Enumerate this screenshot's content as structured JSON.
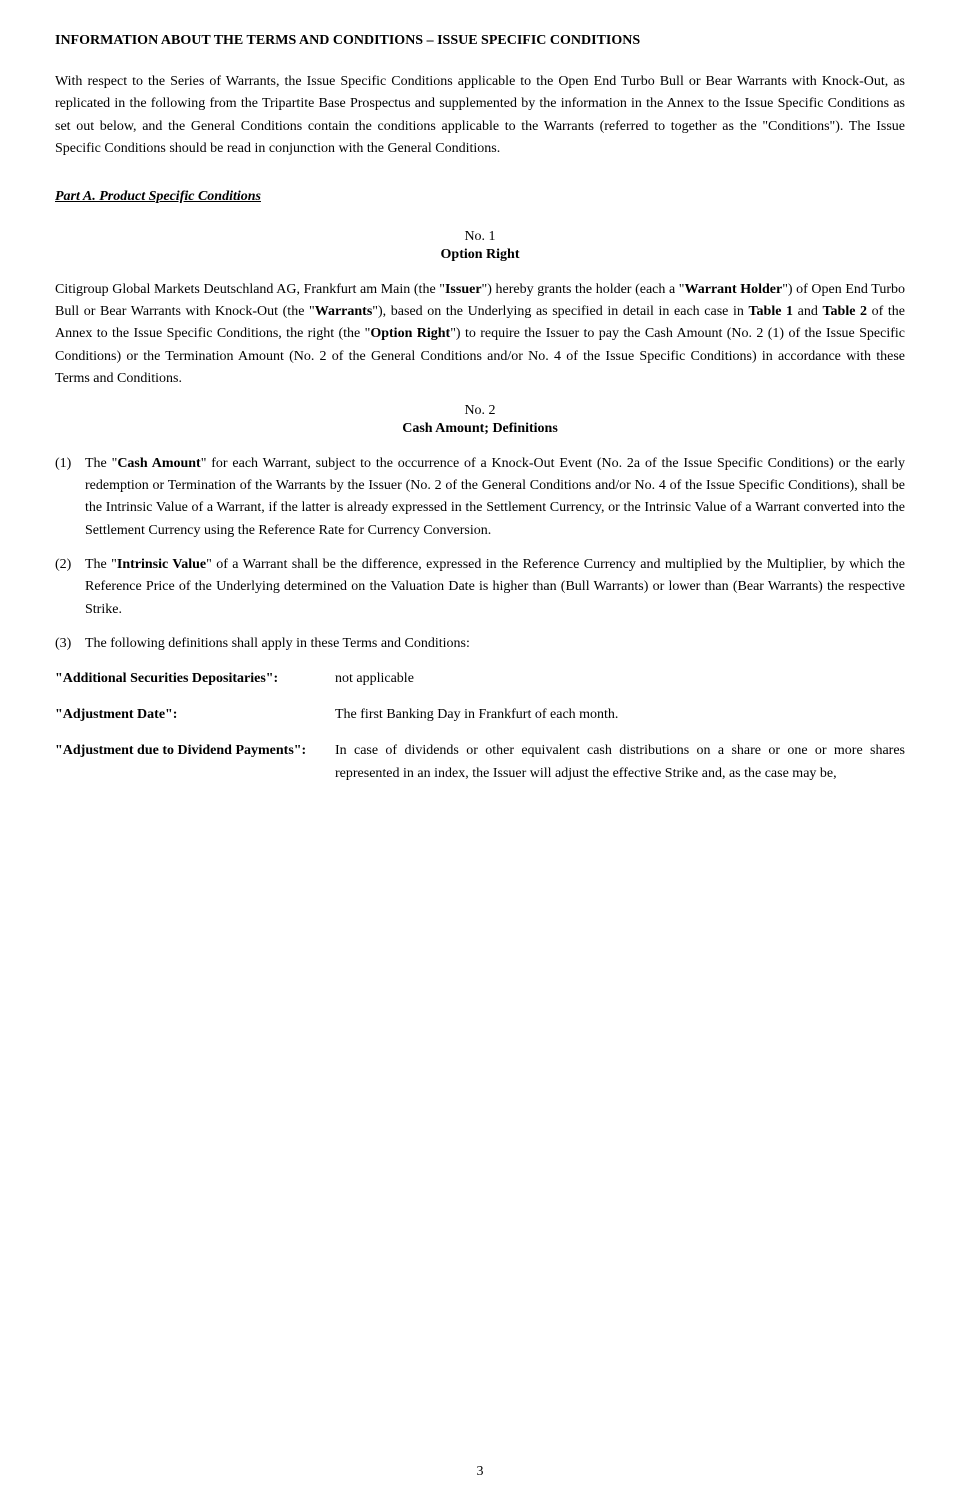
{
  "page": {
    "page_number": "3",
    "main_title": "INFORMATION ABOUT THE TERMS AND CONDITIONS – ISSUE SPECIFIC CONDITIONS",
    "intro_paragraph": "With respect to the Series of Warrants, the Issue Specific Conditions applicable to the Open End Turbo Bull or Bear Warrants with Knock-Out, as replicated in the following from the Tripartite Base Prospectus and supplemented by the information in the Annex to the Issue Specific Conditions as set out below, and the General Conditions contain the conditions applicable to the Warrants (referred to together as the \"Conditions\"). The Issue Specific Conditions should be read in conjunction with the General Conditions.",
    "part_a_heading": "Part A. Product Specific Conditions",
    "section1": {
      "number": "No. 1",
      "title": "Option Right",
      "body": "Citigroup Global Markets Deutschland AG, Frankfurt am Main (the \"Issuer\") hereby grants the holder (each a \"Warrant Holder\") of Open End Turbo Bull or Bear Warrants with Knock-Out (the \"Warrants\"), based on the Underlying as specified in detail in each case in Table 1 and Table 2 of the Annex to the Issue Specific Conditions, the right (the \"Option Right\") to require the Issuer to pay the Cash Amount (No. 2 (1) of the Issue Specific Conditions) or the Termination Amount (No. 2 of the General Conditions and/or No. 4 of the Issue Specific Conditions) in accordance with these Terms and Conditions."
    },
    "section2": {
      "number": "No. 2",
      "title": "Cash Amount; Definitions",
      "item1": {
        "number": "(1)",
        "text_start": "The \"",
        "term": "Cash Amount",
        "text_mid": "\" for each Warrant, subject to the occurrence of a Knock-Out Event (No. 2a of the Issue Specific Conditions) or the early redemption or Termination of the Warrants by the Issuer (No. 2 of the General Conditions and/or No. 4 of the Issue Specific Conditions), shall be the Intrinsic Value of a Warrant, if the latter is already expressed in the Settlement Currency, or the Intrinsic Value of a Warrant converted into the Settlement Currency using the Reference Rate for Currency Conversion."
      },
      "item2": {
        "number": "(2)",
        "text_start": "The \"",
        "term": "Intrinsic Value",
        "text_mid": "\" of a Warrant shall be the difference, expressed in the Reference Currency and multiplied by the Multiplier, by which the Reference Price of the Underlying determined on the Valuation Date is higher than (Bull Warrants) or lower than (Bear Warrants) the respective Strike."
      },
      "item3": {
        "number": "(3)",
        "text": "The following definitions shall apply in these Terms and Conditions:"
      },
      "definitions": [
        {
          "term": "\"Additional Securities Depositaries\":",
          "value": "not applicable"
        },
        {
          "term": "\"Adjustment Date\":",
          "value": "The first Banking Day in Frankfurt of each month."
        },
        {
          "term": "\"Adjustment due to Dividend Payments\":",
          "value": "In case of dividends or other equivalent cash distributions on a share or one or more shares represented in an index, the Issuer will adjust the effective Strike and, as the case may be,"
        }
      ]
    }
  }
}
